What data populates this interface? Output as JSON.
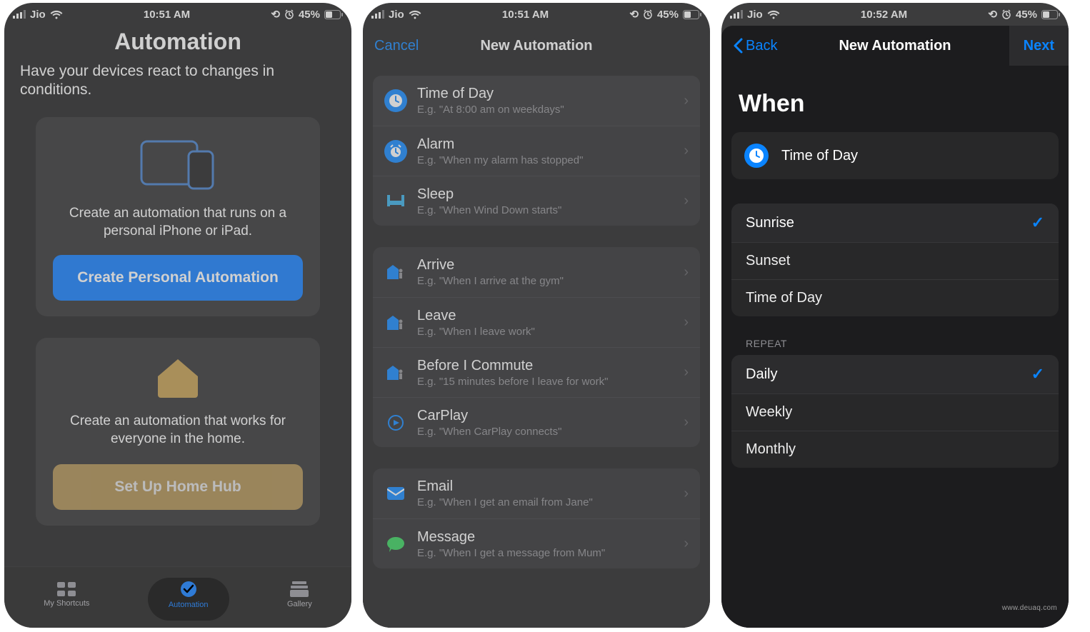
{
  "screens": {
    "s1": {
      "status": {
        "carrier": "Jio",
        "time": "10:51 AM",
        "alarm": true,
        "battery_pct": "45%"
      },
      "title": "Automation",
      "intro": "Have your devices react to changes in conditions.",
      "personal_card_desc": "Create an automation that runs on a personal iPhone or iPad.",
      "personal_button": "Create Personal Automation",
      "home_card_desc": "Create an automation that works for everyone in the home.",
      "home_button": "Set Up Home Hub",
      "tabs": [
        {
          "label": "My Shortcuts"
        },
        {
          "label": "Automation"
        },
        {
          "label": "Gallery"
        }
      ]
    },
    "s2": {
      "status": {
        "carrier": "Jio",
        "time": "10:51 AM",
        "alarm": true,
        "battery_pct": "45%"
      },
      "nav_cancel": "Cancel",
      "nav_title": "New Automation",
      "triggers": [
        {
          "group": 0,
          "icon": "clock",
          "title": "Time of Day",
          "sub": "E.g. \"At 8:00 am on weekdays\"",
          "highlight": true
        },
        {
          "group": 0,
          "icon": "alarm",
          "title": "Alarm",
          "sub": "E.g. \"When my alarm has stopped\""
        },
        {
          "group": 0,
          "icon": "bed",
          "title": "Sleep",
          "sub": "E.g. \"When Wind Down starts\""
        },
        {
          "group": 1,
          "icon": "arrive",
          "title": "Arrive",
          "sub": "E.g. \"When I arrive at the gym\""
        },
        {
          "group": 1,
          "icon": "leave",
          "title": "Leave",
          "sub": "E.g. \"When I leave work\""
        },
        {
          "group": 1,
          "icon": "commute",
          "title": "Before I Commute",
          "sub": "E.g. \"15 minutes before I leave for work\""
        },
        {
          "group": 1,
          "icon": "carplay",
          "title": "CarPlay",
          "sub": "E.g. \"When CarPlay connects\""
        },
        {
          "group": 2,
          "icon": "email",
          "title": "Email",
          "sub": "E.g. \"When I get an email from Jane\""
        },
        {
          "group": 2,
          "icon": "message",
          "title": "Message",
          "sub": "E.g. \"When I get a message from Mum\""
        }
      ]
    },
    "s3": {
      "status": {
        "carrier": "Jio",
        "time": "10:52 AM",
        "alarm": true,
        "battery_pct": "45%"
      },
      "nav_back": "Back",
      "nav_title": "New Automation",
      "nav_next": "Next",
      "when_heading": "When",
      "tod_label": "Time of Day",
      "time_options": [
        {
          "label": "Sunrise",
          "selected": true
        },
        {
          "label": "Sunset",
          "selected": false
        },
        {
          "label": "Time of Day",
          "selected": false
        }
      ],
      "repeat_heading": "REPEAT",
      "repeat_options": [
        {
          "label": "Daily",
          "selected": true
        },
        {
          "label": "Weekly",
          "selected": false
        },
        {
          "label": "Monthly",
          "selected": false
        }
      ]
    }
  },
  "watermark": "www.deuaq.com"
}
